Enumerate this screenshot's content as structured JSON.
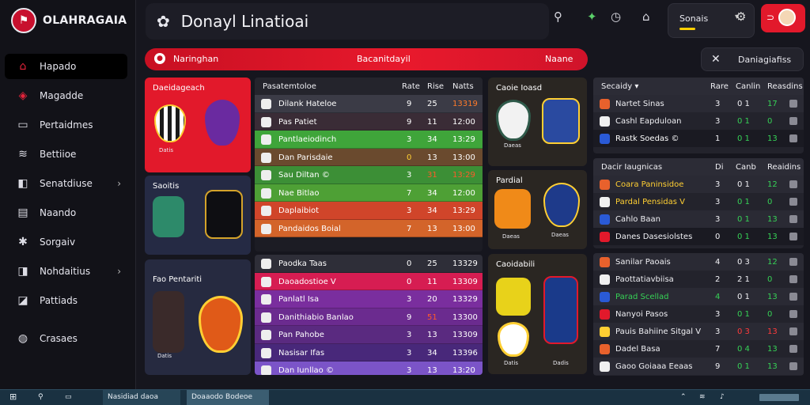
{
  "brand": {
    "name": "OLAHRAGAIA"
  },
  "nav": [
    {
      "label": "Hapado",
      "active": true
    },
    {
      "label": "Magadde"
    },
    {
      "label": "Pertaidmes"
    },
    {
      "label": "Bettiioe"
    },
    {
      "label": "Senatdiuse",
      "chevron": true
    },
    {
      "label": "Naando"
    },
    {
      "label": "Sorgaiv"
    },
    {
      "label": "Nohdaitius",
      "chevron": true
    },
    {
      "label": "Pattiads"
    },
    {
      "label": "Crasaes"
    }
  ],
  "header": {
    "title": "Donayl Linatioai",
    "season": "Sonais"
  },
  "banner": {
    "left": "Naringhan",
    "center": "Bacanitdayil",
    "right": "Naane"
  },
  "close_panel": {
    "label": "Daniagiafiss"
  },
  "cards": {
    "top": {
      "title": "Daeidageach",
      "label": "Datis"
    },
    "middle": {
      "title": "Saoitis",
      "label": ""
    },
    "bottom": {
      "title": "Fao Pentariti",
      "label": "Datis"
    },
    "r1": {
      "title": "Caoie Ioasd",
      "label": "Daeas"
    },
    "r2": {
      "title": "Pardial",
      "label1": "Daeas",
      "label2": "Daeas"
    },
    "r3": {
      "title": "Caoidabili",
      "label1": "Datis",
      "label2": "Dadis"
    }
  },
  "league_table": {
    "headers": {
      "name": "Pasatemtoloe",
      "a": "Rate",
      "b": "Rise",
      "c": "Natts"
    },
    "group1": [
      {
        "name": "Dilank Hateloe",
        "a": "9",
        "b": "25",
        "c": "13319",
        "bg": "#3b3b46",
        "c_color": "#ff7a2a"
      },
      {
        "name": "Pas Patiet",
        "a": "9",
        "b": "11",
        "c": "12:00",
        "bg": "#3a2c36"
      },
      {
        "name": "Pantlaeiodinch",
        "a": "3",
        "b": "34",
        "c": "13:29",
        "bg": "#3fa53a"
      },
      {
        "name": "Dan Parisdaie",
        "a": "0",
        "b": "13",
        "c": "13:00",
        "bg": "#6a4a2e",
        "a_color": "#ffcf33"
      },
      {
        "name": "Sau Diltan ©",
        "a": "3",
        "b": "31",
        "c": "13:29",
        "bg": "#3c8f36",
        "b_color": "#ff5a2a",
        "c_color": "#ff5a2a"
      },
      {
        "name": "Nae Bitlao",
        "a": "7",
        "b": "34",
        "c": "12:00",
        "bg": "#4ea035"
      },
      {
        "name": "Daplaibiot",
        "a": "3",
        "b": "34",
        "c": "13:29",
        "bg": "#d0452a"
      },
      {
        "name": "Pandaidos Boial",
        "a": "7",
        "b": "13",
        "c": "13:00",
        "bg": "#d3642a"
      }
    ],
    "group2": [
      {
        "name": "Paodka Taas",
        "a": "0",
        "b": "25",
        "c": "13329",
        "bg": "#2e2e38"
      },
      {
        "name": "Daoadostioe V",
        "a": "0",
        "b": "11",
        "c": "13309",
        "bg": "#d61d52"
      },
      {
        "name": "Panlatl Isa",
        "a": "3",
        "b": "20",
        "c": "13329",
        "bg": "#7a2e9e"
      },
      {
        "name": "Danithiabio Banlao",
        "a": "9",
        "b": "51",
        "c": "13300",
        "bg": "#6b2b8f",
        "b_color": "#ff5a2a"
      },
      {
        "name": "Pan Pahobe",
        "a": "3",
        "b": "13",
        "c": "13309",
        "bg": "#5a2a80"
      },
      {
        "name": "Nasisar Ifas",
        "a": "3",
        "b": "34",
        "c": "13396",
        "bg": "#48287a"
      },
      {
        "name": "Dan Iunllao ©",
        "a": "3",
        "b": "13",
        "c": "13:20",
        "bg": "#7b54c8"
      }
    ]
  },
  "standings": {
    "s1_header": {
      "name": "Secaidy ▾",
      "a": "Rare",
      "b": "Canlin",
      "c": "Reasdins"
    },
    "s1": [
      {
        "name": "Nartet Sinas",
        "a": "3",
        "b": "0 1",
        "c": "17",
        "c_color": "green"
      },
      {
        "name": "Cashl Eapduloan",
        "a": "3",
        "b": "0 1",
        "c": "0",
        "b_color": "green",
        "c_color": "green"
      },
      {
        "name": "Rastk Soedas ©",
        "a": "1",
        "b": "0 1",
        "c": "13",
        "name_color": "#fff",
        "b_color": "green",
        "c_color": "green",
        "sel": true
      }
    ],
    "s2_header": {
      "name": "Dacir Iaugnicas",
      "a": "Di",
      "b": "Canb",
      "c": "Reaidins"
    },
    "s2": [
      {
        "name": "Coara Paninsidoe",
        "a": "3",
        "b": "0 1",
        "c": "12",
        "name_color": "#ffcf33",
        "c_color": "green"
      },
      {
        "name": "Pardal Pensidas V",
        "a": "3",
        "b": "0 1",
        "c": "0",
        "name_color": "#ffcf33",
        "b_color": "green",
        "c_color": "green"
      },
      {
        "name": "Cahlo Baan",
        "a": "3",
        "b": "0 1",
        "c": "13",
        "b_color": "green",
        "c_color": "green"
      },
      {
        "name": "Danes Dasesiolstes",
        "a": "0",
        "b": "0 1",
        "c": "13",
        "b_color": "green",
        "c_color": "green",
        "sel": true
      }
    ],
    "s3": [
      {
        "name": "Sanilar Paoais",
        "a": "4",
        "b": "0 3",
        "c": "12",
        "c_color": "green"
      },
      {
        "name": "Paottatiavbiisa",
        "a": "2",
        "b": "2 1",
        "c": "0",
        "c_color": "green"
      },
      {
        "name": "Parad Scellad",
        "a": "4",
        "b": "0 1",
        "c": "13",
        "name_color": "#36d156",
        "a_color": "green",
        "c_color": "green"
      },
      {
        "name": "Nanyoi Pasos",
        "a": "3",
        "b": "0 1",
        "c": "0",
        "b_color": "green",
        "c_color": "green"
      },
      {
        "name": "Pauis Bahiine Sitgal V",
        "a": "3",
        "b": "0 3",
        "c": "13",
        "b_color": "red",
        "c_color": "red"
      },
      {
        "name": "Dadel Basa",
        "a": "7",
        "b": "0 4",
        "c": "13",
        "b_color": "green",
        "c_color": "green"
      },
      {
        "name": "Gaoo Goiaaa Eeaas",
        "a": "9",
        "b": "0 1",
        "c": "13",
        "b_color": "green",
        "c_color": "green"
      }
    ]
  },
  "taskbar": {
    "app1": "Nasidiad daoa",
    "app2": "Doaaodo Bodeoe"
  },
  "colors": {
    "accent": "#e2192b",
    "bg": "#16161e"
  }
}
